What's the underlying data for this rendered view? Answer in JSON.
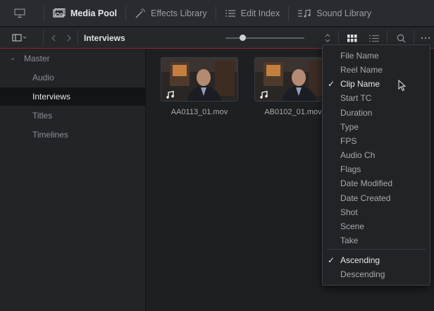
{
  "tabs": [
    {
      "label": "Media Pool",
      "icon": "media-pool-icon",
      "active": true
    },
    {
      "label": "Effects Library",
      "icon": "effects-wand-icon"
    },
    {
      "label": "Edit Index",
      "icon": "list-index-icon"
    },
    {
      "label": "Sound Library",
      "icon": "sound-library-icon"
    }
  ],
  "toolbar": {
    "breadcrumb": "Interviews"
  },
  "sidebar": {
    "root": "Master",
    "items": [
      "Audio",
      "Interviews",
      "Titles",
      "Timelines"
    ],
    "selected": "Interviews"
  },
  "clips": [
    {
      "name": "AA0113_01.mov"
    },
    {
      "name": "AB0102_01.mov"
    }
  ],
  "sort_menu": {
    "fields": [
      "File Name",
      "Reel Name",
      "Clip Name",
      "Start TC",
      "Duration",
      "Type",
      "FPS",
      "Audio Ch",
      "Flags",
      "Date Modified",
      "Date Created",
      "Shot",
      "Scene",
      "Take"
    ],
    "selected_field": "Clip Name",
    "orders": [
      "Ascending",
      "Descending"
    ],
    "selected_order": "Ascending"
  },
  "colors": {
    "accent_red": "#8a2a2a",
    "selected_row": "#131417"
  }
}
